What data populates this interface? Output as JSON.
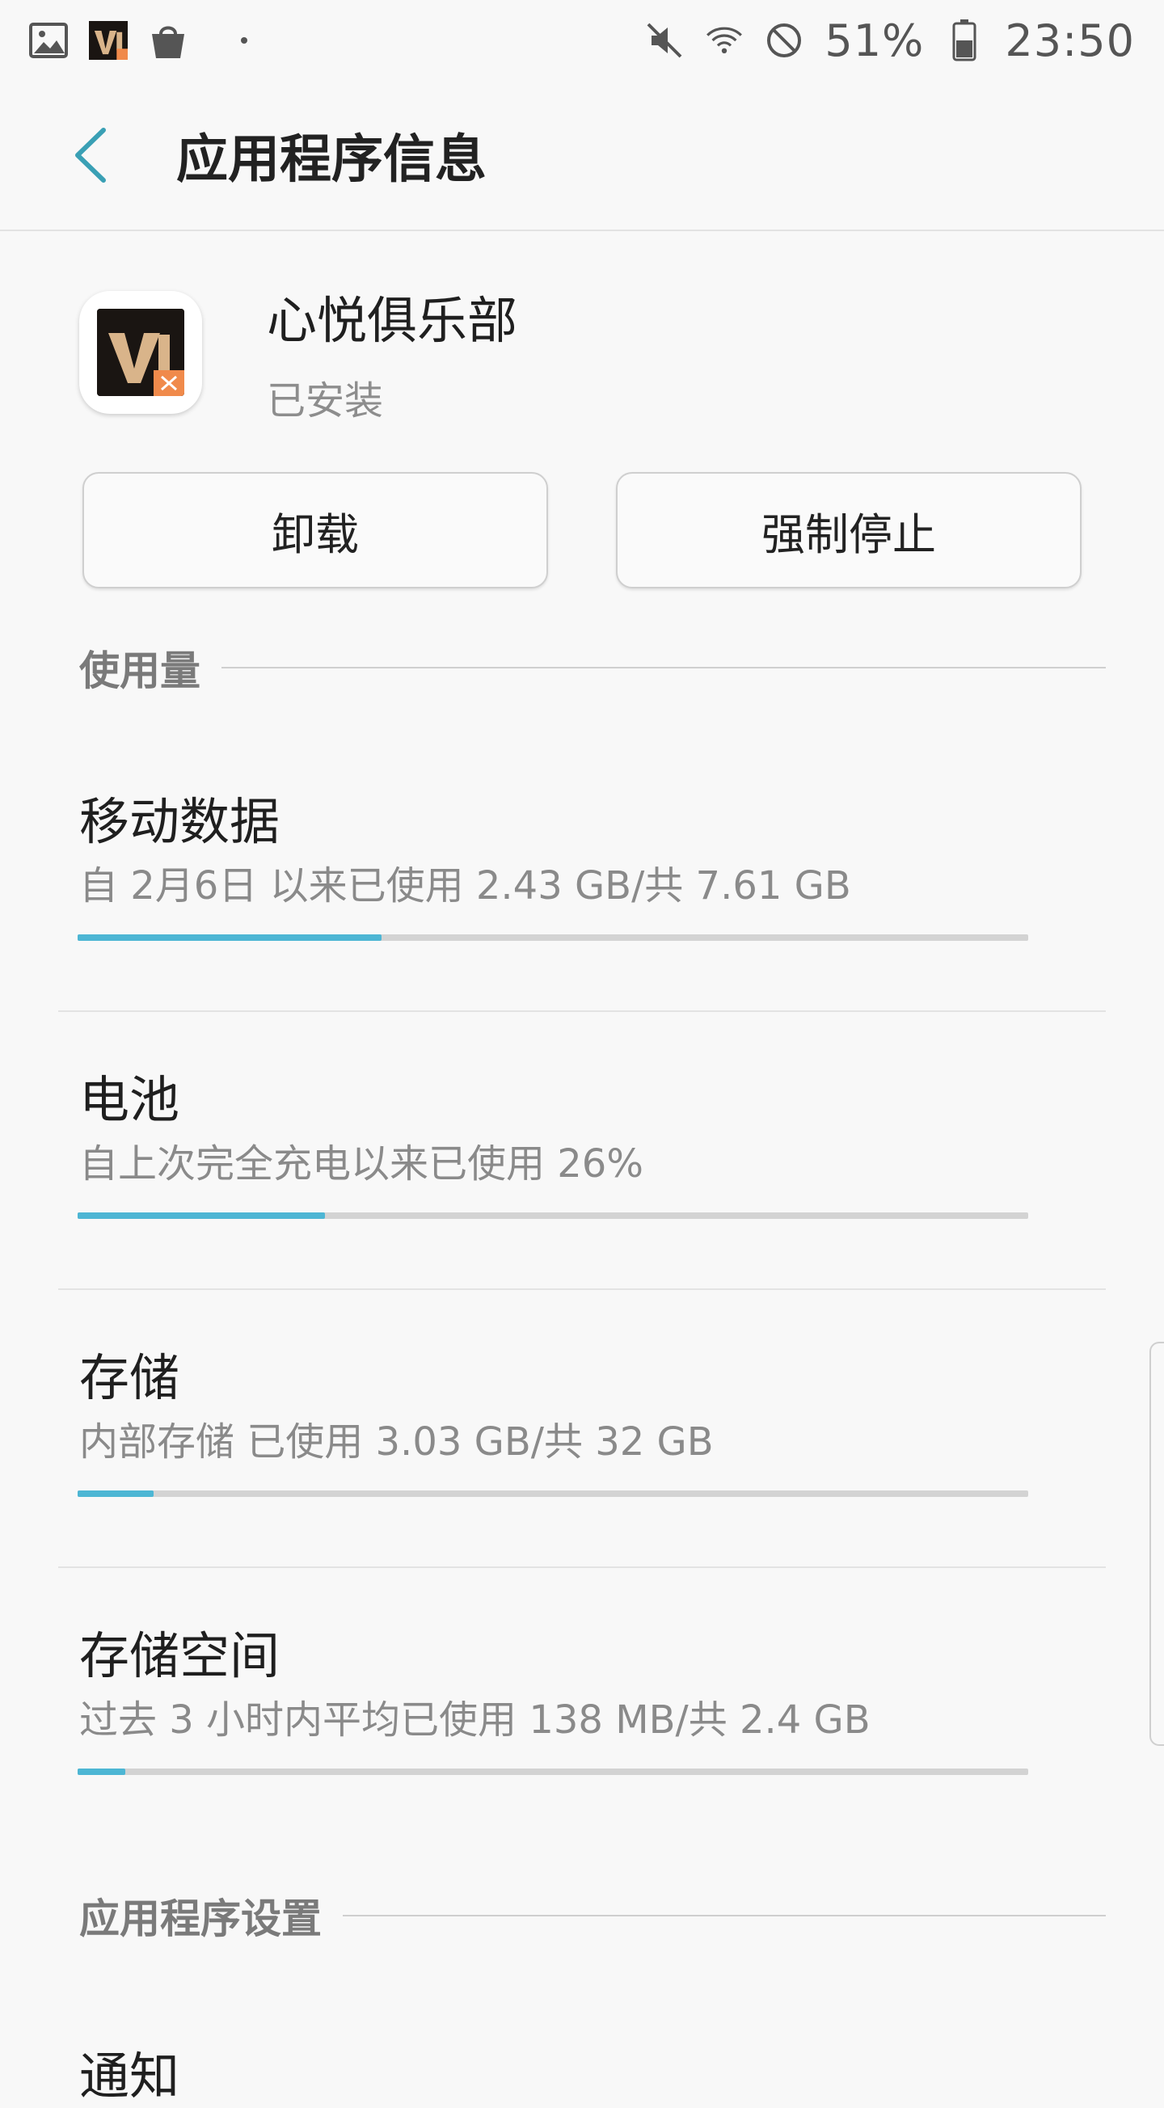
{
  "status_bar": {
    "battery": "51%",
    "time": "23:50",
    "icons": [
      "gallery-icon",
      "vip-app-icon",
      "shopping-bag-icon",
      "mute-icon",
      "wifi-icon",
      "blocked-icon",
      "battery-icon"
    ]
  },
  "app_bar": {
    "title": "应用程序信息"
  },
  "app": {
    "name": "心悦俱乐部",
    "status": "已安装",
    "icon": "vip-app-icon"
  },
  "buttons": {
    "uninstall": "卸载",
    "force_stop": "强制停止"
  },
  "usage_section": {
    "label": "使用量",
    "items": [
      {
        "title": "移动数据",
        "subtitle": "自 2月6日 以来已使用 2.43 GB/共 7.61 GB",
        "progress": 0.32
      },
      {
        "title": "电池",
        "subtitle": "自上次完全充电以来已使用 26%",
        "progress": 0.26
      },
      {
        "title": "存储",
        "subtitle": "内部存储 已使用 3.03 GB/共 32 GB",
        "progress": 0.08
      },
      {
        "title": "存储空间",
        "subtitle": "过去 3 小时内平均已使用 138 MB/共 2.4 GB",
        "progress": 0.05
      }
    ]
  },
  "settings_section": {
    "label": "应用程序设置",
    "first_item": "通知"
  },
  "colors": {
    "accent": "#4db6d4",
    "back_arrow": "#3aa0b5"
  }
}
